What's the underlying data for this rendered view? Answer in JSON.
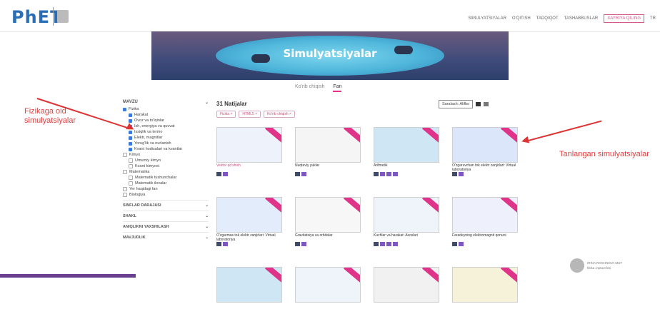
{
  "header": {
    "logo_text": "PhET",
    "nav": [
      "SIMULYATSIYALAR",
      "O'QITISH",
      "TADQIQOT",
      "TASHABBUSLAR"
    ],
    "donate_label": "XAYRIYA QILING",
    "lang": "Tr"
  },
  "banner": {
    "title": "Simulyatsiyalar"
  },
  "tabs": {
    "primary": "Ko'rib chiqish",
    "secondary": "Fan"
  },
  "sidebar": {
    "filter_heading": "MAVZU",
    "filters": [
      {
        "label": "Fizika",
        "checked": true,
        "indent": false
      },
      {
        "label": "Harakat",
        "checked": true,
        "indent": true
      },
      {
        "label": "Ovoz va to'lqinlar",
        "checked": true,
        "indent": true
      },
      {
        "label": "Ish, energiya va quvvat",
        "checked": true,
        "indent": true
      },
      {
        "label": "Issiqlik va termo",
        "checked": true,
        "indent": true
      },
      {
        "label": "Elektr, magnitlar",
        "checked": true,
        "indent": true
      },
      {
        "label": "Yorug'lik va nurlanish",
        "checked": true,
        "indent": true
      },
      {
        "label": "Kvant hodisalari va kvantlar",
        "checked": true,
        "indent": true
      },
      {
        "label": "Kimyo",
        "checked": false,
        "indent": false
      },
      {
        "label": "Umumiy kimyo",
        "checked": false,
        "indent": true
      },
      {
        "label": "Kvant kimyosi",
        "checked": false,
        "indent": true
      },
      {
        "label": "Matematika",
        "checked": false,
        "indent": false
      },
      {
        "label": "Matematik tushunchalar",
        "checked": false,
        "indent": true
      },
      {
        "label": "Matematik ilovalar",
        "checked": false,
        "indent": true
      },
      {
        "label": "Yer haqidagi fan",
        "checked": false,
        "indent": false
      },
      {
        "label": "Biologiya",
        "checked": false,
        "indent": false
      }
    ],
    "sections": [
      "SINFLAR DARAJASI",
      "SHAKL",
      "ANIQLIKNI YAXSHILASH",
      "MAVJUDLIK"
    ]
  },
  "results": {
    "title": "31 Natijalar",
    "chips": [
      "Fizika ×",
      "HTML5 ×",
      "Ko'rib chiqish ×"
    ],
    "sort_label": "Saralash: Alifbo",
    "cards": [
      {
        "title": "Vektor qo'shish",
        "pink": true
      },
      {
        "title": "Nuqtaviy yuklar",
        "pink": false
      },
      {
        "title": "Arifmetik",
        "pink": false
      },
      {
        "title": "O'zgaruvchan tok elektr zanjirlari: Virtual laboratoriya",
        "pink": false
      },
      {
        "title": "O'zgarmas tok elektr zanjirlari: Virtual laboratoriya",
        "pink": false
      },
      {
        "title": "Gravitatsiya va orbitalar",
        "pink": false
      },
      {
        "title": "Kuchlar va harakat: Asoslari",
        "pink": false
      },
      {
        "title": "Faradeyning elektromagnit qonuni",
        "pink": false
      },
      {
        "title": "",
        "pink": false
      },
      {
        "title": "",
        "pink": false
      },
      {
        "title": "",
        "pink": false
      },
      {
        "title": "",
        "pink": false
      }
    ]
  },
  "annotations": {
    "left": "Fizikaga oid simulyatsiyalar",
    "right": "Tanlangan simulyatsiyalar"
  },
  "profile": {
    "name": "IRINA ROSHNOVA MUT",
    "subtitle": "fizika o'qituvchisi"
  },
  "colors": {
    "accent": "#e0338a",
    "brand_blue": "#2a6fb6",
    "annotation_red": "#e04040"
  }
}
